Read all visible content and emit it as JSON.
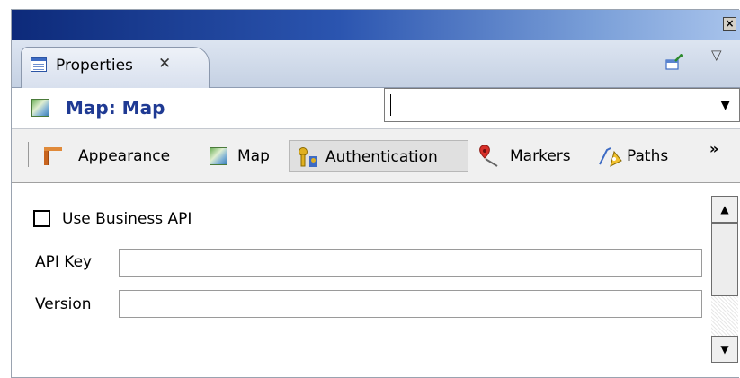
{
  "window": {
    "close_symbol": "×"
  },
  "view_tab": {
    "label": "Properties",
    "close_symbol": "✕",
    "icon": "properties-icon"
  },
  "view_toolbar": {
    "pin_icon": "pin-icon",
    "menu_symbol": "▽"
  },
  "header": {
    "title": "Map: Map",
    "combo": {
      "value": "",
      "arrow": "▼"
    }
  },
  "sections": [
    {
      "label": "Appearance",
      "icon": "appearance-icon",
      "selected": false
    },
    {
      "label": "Map",
      "icon": "map-icon",
      "selected": false
    },
    {
      "label": "Authentication",
      "icon": "keys-icon",
      "selected": true
    },
    {
      "label": "Markers",
      "icon": "marker-icon",
      "selected": false
    },
    {
      "label": "Paths",
      "icon": "paths-icon",
      "selected": false
    }
  ],
  "more_symbol": "»",
  "form": {
    "use_business_api": {
      "label": "Use Business API",
      "checked": false
    },
    "api_key": {
      "label": "API Key",
      "value": ""
    },
    "version": {
      "label": "Version",
      "value": ""
    }
  },
  "scrollbar": {
    "up_symbol": "▲",
    "down_symbol": "▼"
  },
  "colors": {
    "title_gradient_start": "#0d2a7a",
    "header_title": "#1f3a93"
  }
}
